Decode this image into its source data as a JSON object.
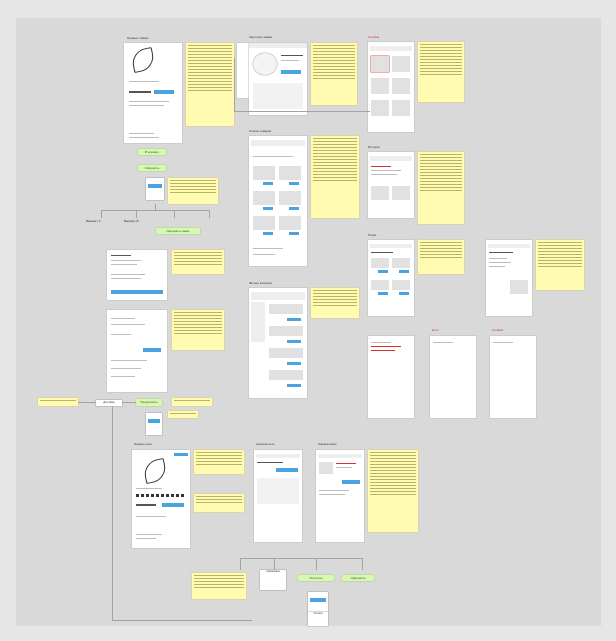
{
  "board": {
    "frames": {
      "product_top": "Превью товара",
      "product_card": "Карточка товара",
      "catalog": "Список товаров",
      "catalog_filter": "Фильтр каталога",
      "history": "История",
      "search": "Поиск",
      "cart_preview": "Превью сета",
      "cart": "Корзина сета",
      "checkout": "Оформление"
    },
    "red_labels": [
      "Ошибка",
      "Error",
      "Ошибка"
    ],
    "green_buttons": {
      "add_to_cart": "В корзину",
      "open_product": "Оформить",
      "order_confirm": "Оформить заказ",
      "branch_a": "Продолжить",
      "branch_b": "Оплатить"
    },
    "flow_boxes": {
      "option_a": "Вариант A",
      "option_b": "Вариант B",
      "delivery": "Доставка",
      "pickup": "Самовывоз",
      "payment": "Оплата"
    }
  },
  "colors": {
    "board": "#d9d9d9",
    "note": "#fffbb0",
    "green": "#d7f7b2",
    "accent": "#4aa3df",
    "error": "#d9302c"
  }
}
